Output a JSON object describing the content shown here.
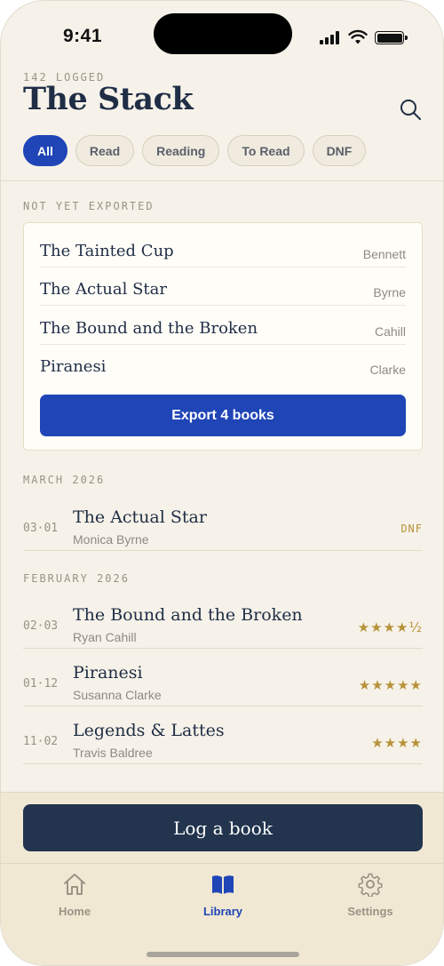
{
  "status_bar": {
    "time": "9:41"
  },
  "header": {
    "logged_count": "142 LOGGED",
    "title": "The Stack"
  },
  "filters": [
    {
      "label": "All",
      "active": true
    },
    {
      "label": "Read",
      "active": false
    },
    {
      "label": "Reading",
      "active": false
    },
    {
      "label": "To Read",
      "active": false
    },
    {
      "label": "DNF",
      "active": false
    }
  ],
  "not_exported": {
    "label": "NOT YET EXPORTED",
    "books": [
      {
        "title": "The Tainted Cup",
        "author": "Bennett"
      },
      {
        "title": "The Actual Star",
        "author": "Byrne"
      },
      {
        "title": "The Bound and the Broken",
        "author": "Cahill"
      },
      {
        "title": "Piranesi",
        "author": "Clarke"
      }
    ],
    "export_button": "Export 4 books"
  },
  "sections": [
    {
      "label": "MARCH 2026",
      "entries": [
        {
          "date": "03·01",
          "title": "The Actual Star",
          "author": "Monica Byrne",
          "status": "DNF"
        }
      ]
    },
    {
      "label": "FEBRUARY 2026",
      "entries": [
        {
          "date": "02·03",
          "title": "The Bound and the Broken",
          "author": "Ryan Cahill",
          "rating": "★★★★½",
          "rating_value": 4.5
        },
        {
          "date": "01·12",
          "title": "Piranesi",
          "author": "Susanna Clarke",
          "rating": "★★★★★",
          "rating_value": 5
        },
        {
          "date": "11·02",
          "title": "Legends & Lattes",
          "author": "Travis Baldree",
          "rating": "★★★★",
          "rating_value": 4
        }
      ]
    }
  ],
  "log_button": "Log a book",
  "tab_bar": [
    {
      "label": "Home",
      "icon": "home-icon",
      "active": false
    },
    {
      "label": "Library",
      "icon": "book-icon",
      "active": true
    },
    {
      "label": "Settings",
      "icon": "gear-icon",
      "active": false
    }
  ],
  "colors": {
    "accent": "#1f45b7",
    "navy": "#22344e",
    "gold": "#b8923a",
    "background": "#f6f2e9"
  }
}
